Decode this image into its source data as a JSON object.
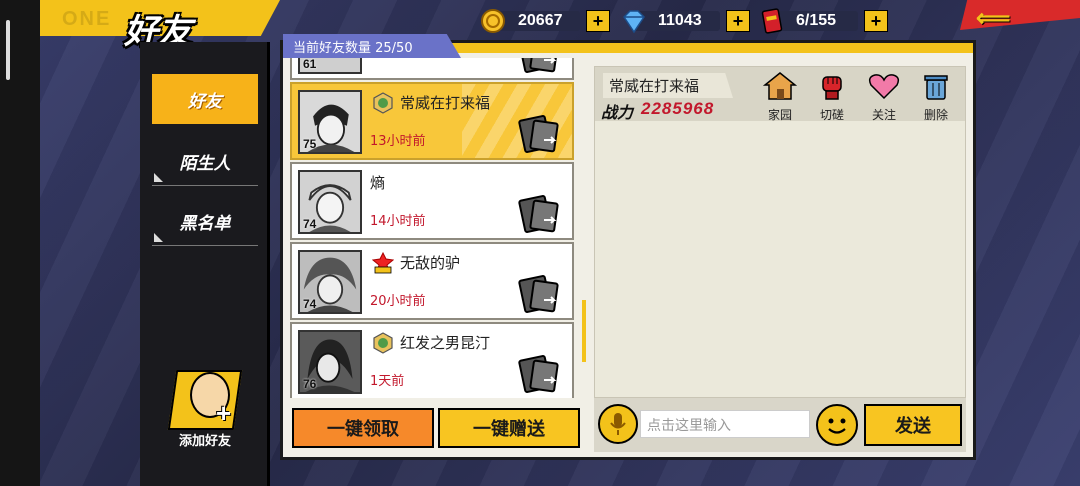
{
  "header": {
    "title": "好友",
    "banner_text": "ONE"
  },
  "currencies": [
    {
      "icon": "gold-coin-icon",
      "value": "20667"
    },
    {
      "icon": "diamond-icon",
      "value": "11043"
    },
    {
      "icon": "red-ticket-icon",
      "value": "6/155"
    }
  ],
  "sidebar": {
    "items": [
      {
        "label": "好友",
        "active": true
      },
      {
        "label": "陌生人",
        "active": false
      },
      {
        "label": "黑名单",
        "active": false
      }
    ],
    "add_friend_label": "添加好友"
  },
  "friend_count_label": "当前好友数量 25/50",
  "friends": [
    {
      "name": "常威在打来福",
      "level": "75",
      "time": "13小时前",
      "badge": "green-emblem-icon",
      "selected": true
    },
    {
      "name": "熵",
      "level": "74",
      "time": "14小时前",
      "badge": "",
      "selected": false
    },
    {
      "name": "无敌的驴",
      "level": "74",
      "time": "20小时前",
      "badge": "power-badge-icon",
      "selected": false
    },
    {
      "name": "红发之男昆汀",
      "level": "76",
      "time": "1天前",
      "badge": "green-emblem-icon",
      "selected": false
    }
  ],
  "partial_row_level": "61",
  "actions": {
    "claim_all": "一键领取",
    "gift_all": "一键赠送"
  },
  "detail": {
    "name": "常威在打来福",
    "power_label": "战力",
    "power_value": "2285968",
    "buttons": [
      {
        "label": "家园",
        "icon": "home-icon"
      },
      {
        "label": "切磋",
        "icon": "fist-icon"
      },
      {
        "label": "关注",
        "icon": "heart-icon"
      },
      {
        "label": "删除",
        "icon": "trash-icon"
      }
    ]
  },
  "chat": {
    "placeholder": "点击这里输入",
    "send_label": "发送"
  },
  "colors": {
    "accent_yellow": "#f3c21a",
    "orange": "#f6892a",
    "time_red": "#c2182c"
  }
}
